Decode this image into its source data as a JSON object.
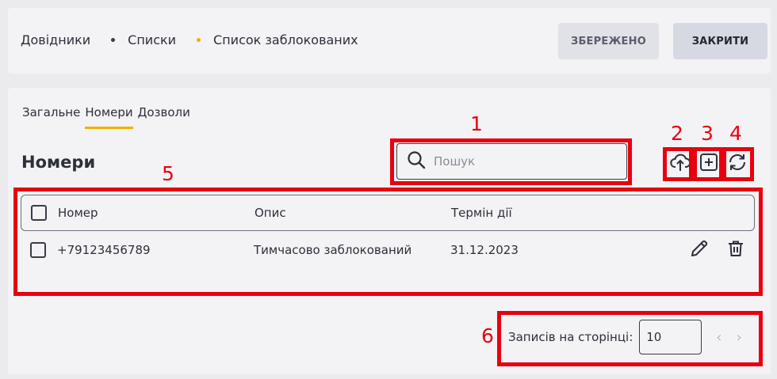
{
  "breadcrumb": {
    "items": [
      "Довідники",
      "Списки",
      "Список заблокованих"
    ],
    "dot_colors": [
      "#3a3c47",
      "#f0b000"
    ]
  },
  "header": {
    "saved_label": "ЗБЕРЕЖЕНО",
    "close_label": "ЗАКРИТИ"
  },
  "tabs": [
    {
      "label": "Загальне",
      "active": false
    },
    {
      "label": "Номери",
      "active": true
    },
    {
      "label": "Дозволи",
      "active": false
    }
  ],
  "section": {
    "title": "Номери"
  },
  "search": {
    "placeholder": "Пошук",
    "value": ""
  },
  "toolbar": {
    "icons": [
      "upload-icon",
      "add-icon",
      "refresh-icon"
    ]
  },
  "table": {
    "columns": [
      "Номер",
      "Опис",
      "Термін дії"
    ],
    "rows": [
      {
        "number": "+79123456789",
        "description": "Тимчасово заблокований",
        "expires": "31.12.2023",
        "checked": false
      }
    ]
  },
  "pagination": {
    "label": "Записів на сторінці:",
    "per_page": "10"
  },
  "annotations": [
    "1",
    "2",
    "3",
    "4",
    "5",
    "6"
  ],
  "colors": {
    "accent": "#f0b000",
    "annotation": "#e8000f"
  }
}
